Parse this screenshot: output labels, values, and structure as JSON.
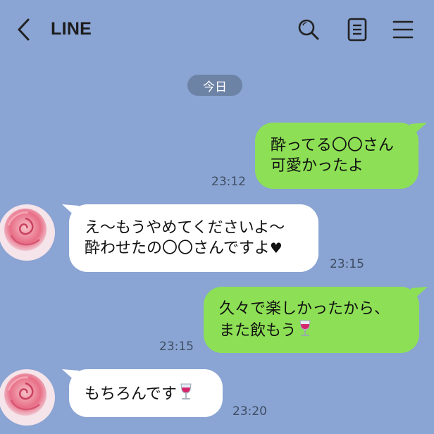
{
  "header": {
    "title": "LINE",
    "icons": [
      "back-arrow-icon",
      "search-icon",
      "notes-icon",
      "menu-icon"
    ]
  },
  "date_label": "今日",
  "messages": [
    {
      "side": "out",
      "lines": [
        "酔ってる〇〇さん",
        "可愛かったよ"
      ],
      "time": "23:12"
    },
    {
      "side": "in",
      "lines": [
        "え〜もうやめてくださいよ〜",
        "酔わせたの〇〇さんですよ"
      ],
      "suffix": "♥",
      "time": "23:15"
    },
    {
      "side": "out",
      "lines": [
        "久々で楽しかったから、",
        "また飲もう"
      ],
      "emoji": "wine-glass-icon",
      "time": "23:15"
    },
    {
      "side": "in",
      "lines": [
        "もちろんです"
      ],
      "emoji": "wine-glass-icon",
      "time": "23:20"
    }
  ],
  "colors": {
    "background": "#8aa4d3",
    "outgoing_bubble": "#8de055",
    "incoming_bubble": "#ffffff",
    "date_chip": "#6d83a6"
  },
  "avatar": "rose-photo"
}
